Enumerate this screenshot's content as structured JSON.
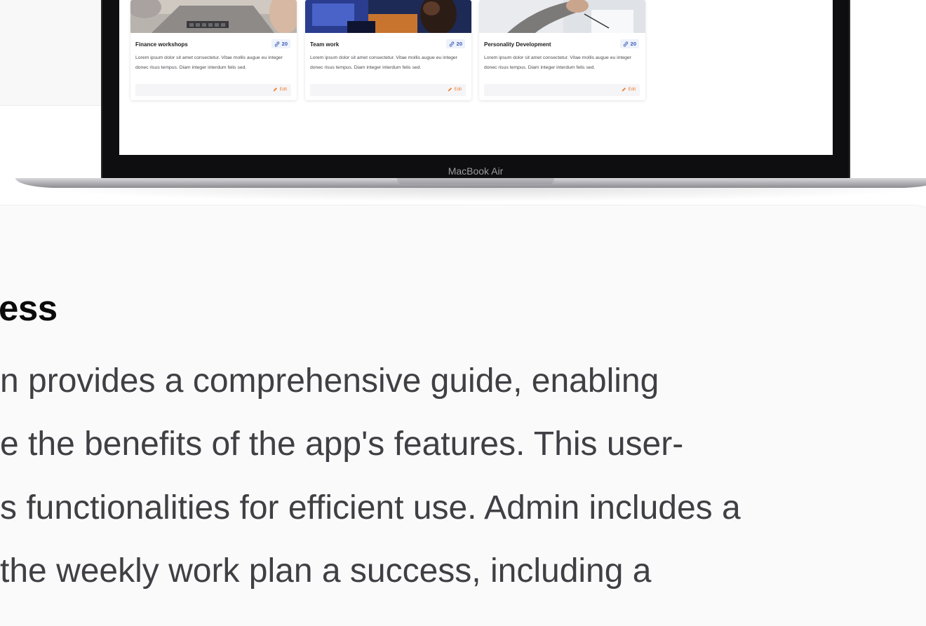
{
  "laptop": {
    "model_label": "MacBook Air"
  },
  "cards": [
    {
      "title": "Finance workshops",
      "count": "20",
      "description": "Lorem ipsum dolor sit amet consectetur. Vitae mollis augue eu integer donec risus tempus. Diam integer interdum felis sed.",
      "edit_label": "Edit"
    },
    {
      "title": "Team work",
      "count": "20",
      "description": "Lorem ipsum dolor sit amet consectetur. Vitae mollis augue eu integer donec risus tempus. Diam integer interdum felis sed.",
      "edit_label": "Edit"
    },
    {
      "title": "Personality Development",
      "count": "20",
      "description": "Lorem ipsum dolor sit amet consectetur. Vitae mollis augue eu integer donec risus tempus. Diam integer interdum felis sed.",
      "edit_label": "Edit"
    }
  ],
  "section": {
    "heading": "ess",
    "lines": [
      "n provides a comprehensive guide, enabling",
      "e the benefits of the app's features. This user-",
      "s functionalities for efficient use. Admin includes a",
      " the weekly work plan a success, including a"
    ]
  },
  "colors": {
    "accent_orange": "#f07b2a",
    "badge_blue": "#3b5bb5",
    "heading": "#0b0b0c",
    "body_text": "#3f3f44"
  }
}
